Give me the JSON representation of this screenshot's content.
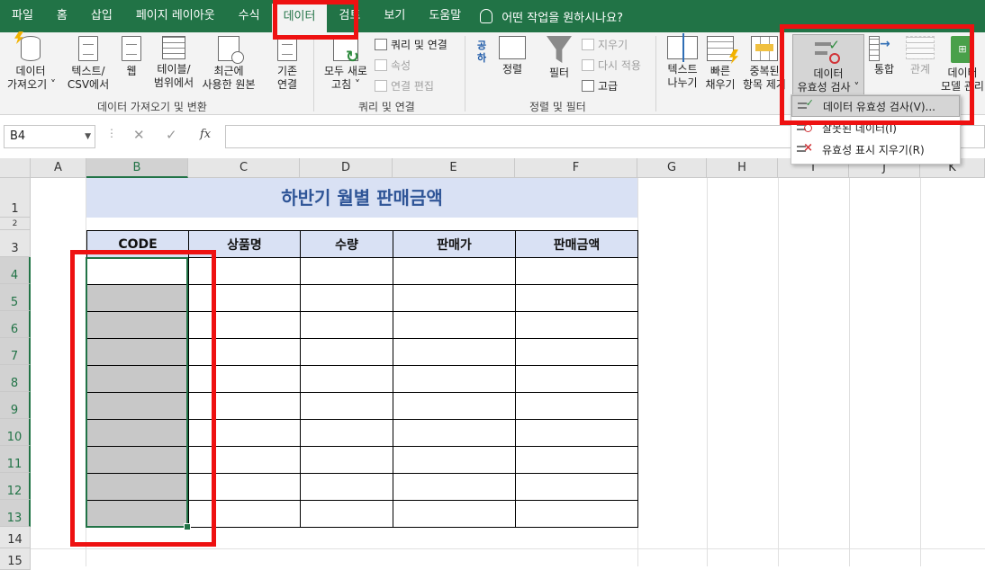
{
  "tabs": [
    "파일",
    "홈",
    "삽입",
    "페이지 레이아웃",
    "수식",
    "데이터",
    "검토",
    "보기",
    "도움말"
  ],
  "tell_me": "어떤 작업을 원하시나요?",
  "ribbon": {
    "get_data": "데이터\n가져오기 ˅",
    "from_text": "텍스트/\nCSV에서",
    "from_web": "웹",
    "from_table": "테이블/\n범위에서",
    "recent": "최근에\n사용한 원본",
    "existing": "기존\n연결",
    "group1_label": "데이터 가져오기 및 변환",
    "refresh_all": "모두 새로\n고침 ˅",
    "queries": "쿼리 및 연결",
    "properties": "속성",
    "edit_links": "연결 편집",
    "group2_label": "쿼리 및 연결",
    "sort_az": "공\n하",
    "sort": "정렬",
    "filter": "필터",
    "clear": "지우기",
    "reapply": "다시 적용",
    "advanced": "고급",
    "group3_label": "정렬 및 필터",
    "text_to_cols": "텍스트\n나누기",
    "flash_fill": "빠른\n채우기",
    "remove_dup": "중복된\n항목 제거",
    "validation": "데이터\n유효성 검사 ˅",
    "consolidate": "통합",
    "relations": "관계",
    "data_model": "데이터\n모델 관리"
  },
  "dropdown": [
    "데이터 유효성 검사(V)...",
    "잘못된 데이터(I)",
    "유효성 표시 지우기(R)"
  ],
  "namebox": "B4",
  "formula": "",
  "columns": [
    "A",
    "B",
    "C",
    "D",
    "E",
    "F",
    "G",
    "H",
    "I",
    "J",
    "K"
  ],
  "rows": [
    "1",
    "2",
    "3",
    "4",
    "5",
    "6",
    "7",
    "8",
    "9",
    "10",
    "11",
    "12",
    "13",
    "14",
    "15"
  ],
  "sheet": {
    "title": "하반기 월별 판매금액",
    "headers": [
      "CODE",
      "상품명",
      "수량",
      "판매가",
      "판매금액"
    ]
  }
}
